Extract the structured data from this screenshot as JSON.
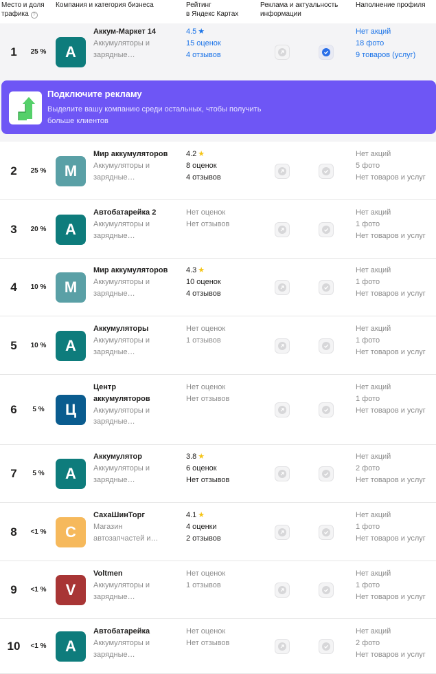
{
  "header": {
    "col_place": "Место и доля трафика",
    "col_company": "Компания и категория бизнеса",
    "col_rating_line1": "Рейтинг",
    "col_rating_line2": "в Яндекс Картах",
    "col_ads_line1": "Реклама и актуальность",
    "col_ads_line2": "информации",
    "col_profile": "Наполнение профиля",
    "help_icon": "?"
  },
  "promo": {
    "title": "Подключите рекламу",
    "text": "Выделите вашу компанию среди остальных, чтобы получить больше клиентов",
    "accent_color": "#6e56f5"
  },
  "rows": [
    {
      "rank": "1",
      "share": "25 %",
      "letter": "А",
      "color": "#0e7c7c",
      "name": "Аккум-Маркет 14",
      "category": [
        "Аккумуляторы и",
        "зарядные…"
      ],
      "rating_lines": [
        "4.5",
        "15 оценок",
        "4 отзывов"
      ],
      "has_stars": true,
      "verified": true,
      "profile": [
        "Нет акций",
        "18 фото",
        "9 товаров (услуг)"
      ],
      "highlight": true
    },
    {
      "rank": "2",
      "share": "25 %",
      "letter": "М",
      "color": "#5aa0a6",
      "name": "Мир аккумуляторов",
      "category": [
        "Аккумуляторы и",
        "зарядные…"
      ],
      "rating_lines": [
        "4.2",
        "8 оценок",
        "4 отзывов"
      ],
      "has_stars": true,
      "verified": false,
      "profile": [
        "Нет акций",
        "5 фото",
        "Нет товаров и услуг"
      ]
    },
    {
      "rank": "3",
      "share": "20 %",
      "letter": "А",
      "color": "#0e7c7c",
      "name": "Автобатарейка 2",
      "category": [
        "Аккумуляторы и",
        "зарядные…"
      ],
      "rating_lines": [
        "Нет оценок",
        "Нет отзывов"
      ],
      "has_stars": false,
      "verified": false,
      "profile": [
        "Нет акций",
        "1 фото",
        "Нет товаров и услуг"
      ]
    },
    {
      "rank": "4",
      "share": "10 %",
      "letter": "М",
      "color": "#5aa0a6",
      "name": "Мир аккумуляторов",
      "category": [
        "Аккумуляторы и",
        "зарядные…"
      ],
      "rating_lines": [
        "4.3",
        "10 оценок",
        "4 отзывов"
      ],
      "has_stars": true,
      "verified": false,
      "profile": [
        "Нет акций",
        "1 фото",
        "Нет товаров и услуг"
      ]
    },
    {
      "rank": "5",
      "share": "10 %",
      "letter": "А",
      "color": "#0e7c7c",
      "name": "Аккумуляторы",
      "category": [
        "Аккумуляторы и",
        "зарядные…"
      ],
      "rating_lines": [
        "Нет оценок",
        "1 отзывов"
      ],
      "has_stars": false,
      "verified": false,
      "profile": [
        "Нет акций",
        "1 фото",
        "Нет товаров и услуг"
      ]
    },
    {
      "rank": "6",
      "share": "5 %",
      "letter": "Ц",
      "color": "#0a5c8f",
      "name": "Центр аккумуляторов",
      "category": [
        "Аккумуляторы и",
        "зарядные…"
      ],
      "rating_lines": [
        "Нет оценок",
        "Нет отзывов"
      ],
      "has_stars": false,
      "verified": false,
      "profile": [
        "Нет акций",
        "1 фото",
        "Нет товаров и услуг"
      ]
    },
    {
      "rank": "7",
      "share": "5 %",
      "letter": "А",
      "color": "#0e7c7c",
      "name": "Аккумулятор",
      "category": [
        "Аккумуляторы и",
        "зарядные…"
      ],
      "rating_lines": [
        "3.8",
        "6 оценок",
        "Нет отзывов"
      ],
      "has_stars": true,
      "verified": false,
      "profile": [
        "Нет акций",
        "2 фото",
        "Нет товаров и услуг"
      ]
    },
    {
      "rank": "8",
      "share": "<1 %",
      "letter": "С",
      "color": "#f6b95c",
      "name": "СахаШинТорг",
      "category": [
        "Магазин",
        "автозапчастей и…"
      ],
      "rating_lines": [
        "4.1",
        "4 оценки",
        "2 отзывов"
      ],
      "has_stars": true,
      "verified": false,
      "profile": [
        "Нет акций",
        "1 фото",
        "Нет товаров и услуг"
      ]
    },
    {
      "rank": "9",
      "share": "<1 %",
      "letter": "V",
      "color": "#a83535",
      "name": "Voltmen",
      "category": [
        "Аккумуляторы и",
        "зарядные…"
      ],
      "rating_lines": [
        "Нет оценок",
        "1 отзывов"
      ],
      "has_stars": false,
      "verified": false,
      "profile": [
        "Нет акций",
        "1 фото",
        "Нет товаров и услуг"
      ]
    },
    {
      "rank": "10",
      "share": "<1 %",
      "letter": "А",
      "color": "#0e7c7c",
      "name": "Автобатарейка",
      "category": [
        "Аккумуляторы и",
        "зарядные…"
      ],
      "rating_lines": [
        "Нет оценок",
        "Нет отзывов"
      ],
      "has_stars": false,
      "verified": false,
      "profile": [
        "Нет акций",
        "2 фото",
        "Нет товаров и услуг"
      ]
    }
  ]
}
